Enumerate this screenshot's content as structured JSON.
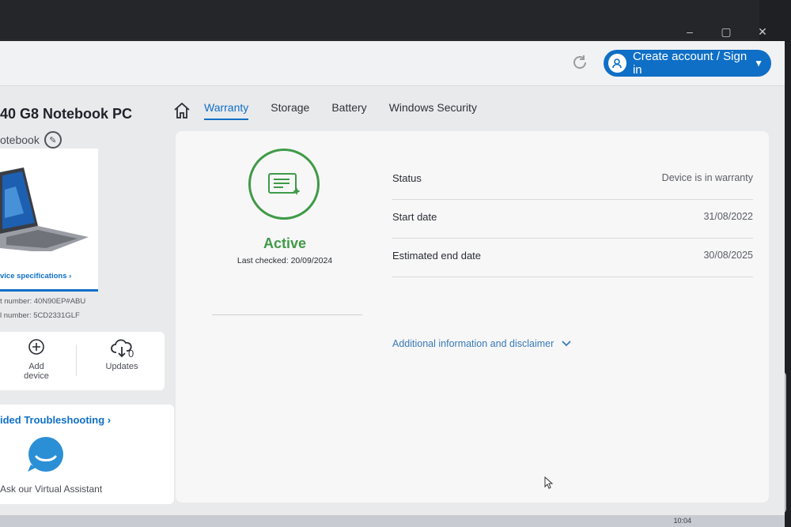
{
  "window": {
    "controls": [
      "–",
      "▢",
      "✕"
    ]
  },
  "header": {
    "signin_label": "Create account / Sign in",
    "icons": [
      "refresh-icon",
      "user-icon",
      "chevron-down-icon"
    ]
  },
  "device": {
    "title": "40 G8 Notebook PC",
    "subtitle": "otebook",
    "specs_link": "vice specifications ›",
    "product_number": "t number: 40N90EP#ABU",
    "serial_number": "l number: 5CD2331GLF"
  },
  "actions": {
    "add_device": "Add device",
    "updates": "Updates",
    "updates_count": "0"
  },
  "assistant": {
    "link": "ided Troubleshooting ›",
    "text": "Ask our Virtual Assistant"
  },
  "tabs": [
    {
      "label": "Warranty",
      "active": true
    },
    {
      "label": "Storage",
      "active": false
    },
    {
      "label": "Battery",
      "active": false
    },
    {
      "label": "Windows Security",
      "active": false
    }
  ],
  "warranty": {
    "status_big": "Active",
    "last_checked": "Last checked: 20/09/2024",
    "rows": [
      {
        "label": "Status",
        "value": "Device is in warranty"
      },
      {
        "label": "Start date",
        "value": "31/08/2022"
      },
      {
        "label": "Estimated end date",
        "value": "30/08/2025"
      }
    ],
    "more_link": "Additional information and disclaimer"
  },
  "taskbar": {
    "time": "10:04"
  },
  "colors": {
    "accent": "#0f6fc6",
    "active_green": "#3f9a47"
  }
}
